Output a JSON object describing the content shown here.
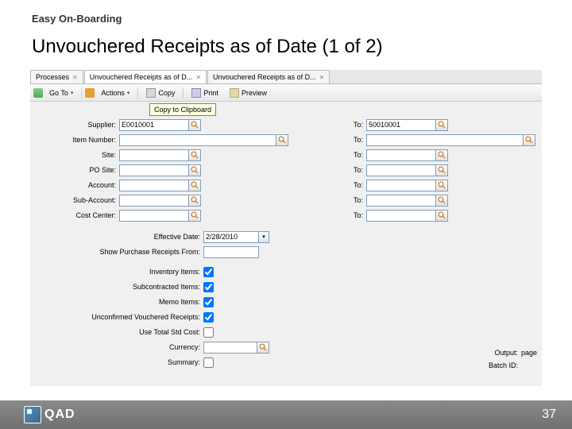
{
  "header_small": "Easy On-Boarding",
  "title": "Unvouchered Receipts as of Date (1 of 2)",
  "tabs": [
    {
      "label": "Processes",
      "active": false
    },
    {
      "label": "Unvouchered Receipts as of D...",
      "active": true
    },
    {
      "label": "Unvouchered Receipts as of D...",
      "active": false
    }
  ],
  "toolbar": {
    "goto": "Go To",
    "actions": "Actions",
    "copy": "Copy",
    "print": "Print",
    "preview": "Preview"
  },
  "tooltip": "Copy to Clipboard",
  "fields": {
    "supplier": {
      "label": "Supplier:",
      "value": "E0010001",
      "to_label": "To:",
      "to_value": "50010001"
    },
    "item": {
      "label": "Item Number:",
      "value": "",
      "to_label": "To:",
      "to_value": ""
    },
    "site": {
      "label": "Site:",
      "value": "",
      "to_label": "To:",
      "to_value": ""
    },
    "posite": {
      "label": "PO Site:",
      "value": "",
      "to_label": "To:",
      "to_value": ""
    },
    "account": {
      "label": "Account:",
      "value": "",
      "to_label": "To:",
      "to_value": ""
    },
    "subaccount": {
      "label": "Sub-Account:",
      "value": "",
      "to_label": "To:",
      "to_value": ""
    },
    "costcenter": {
      "label": "Cost Center:",
      "value": "",
      "to_label": "To:",
      "to_value": ""
    },
    "effdate": {
      "label": "Effective Date:",
      "value": "2/28/2010"
    },
    "showfrom": {
      "label": "Show Purchase Receipts From:",
      "value": ""
    },
    "inventory": {
      "label": "Inventory Items:",
      "checked": true
    },
    "subcontracted": {
      "label": "Subcontracted Items:",
      "checked": true
    },
    "memo": {
      "label": "Memo Items:",
      "checked": true
    },
    "unconfirmed": {
      "label": "Unconfirmed Vouchered Receipts:",
      "checked": true
    },
    "usestd": {
      "label": "Use Total Std Cost:",
      "checked": false
    },
    "currency": {
      "label": "Currency:",
      "value": ""
    },
    "summary": {
      "label": "Summary:",
      "checked": false
    }
  },
  "output": {
    "label": "Output:",
    "value": "page"
  },
  "batch": {
    "label": "Batch ID:",
    "value": ""
  },
  "logo_text": "QAD",
  "page_number": "37"
}
